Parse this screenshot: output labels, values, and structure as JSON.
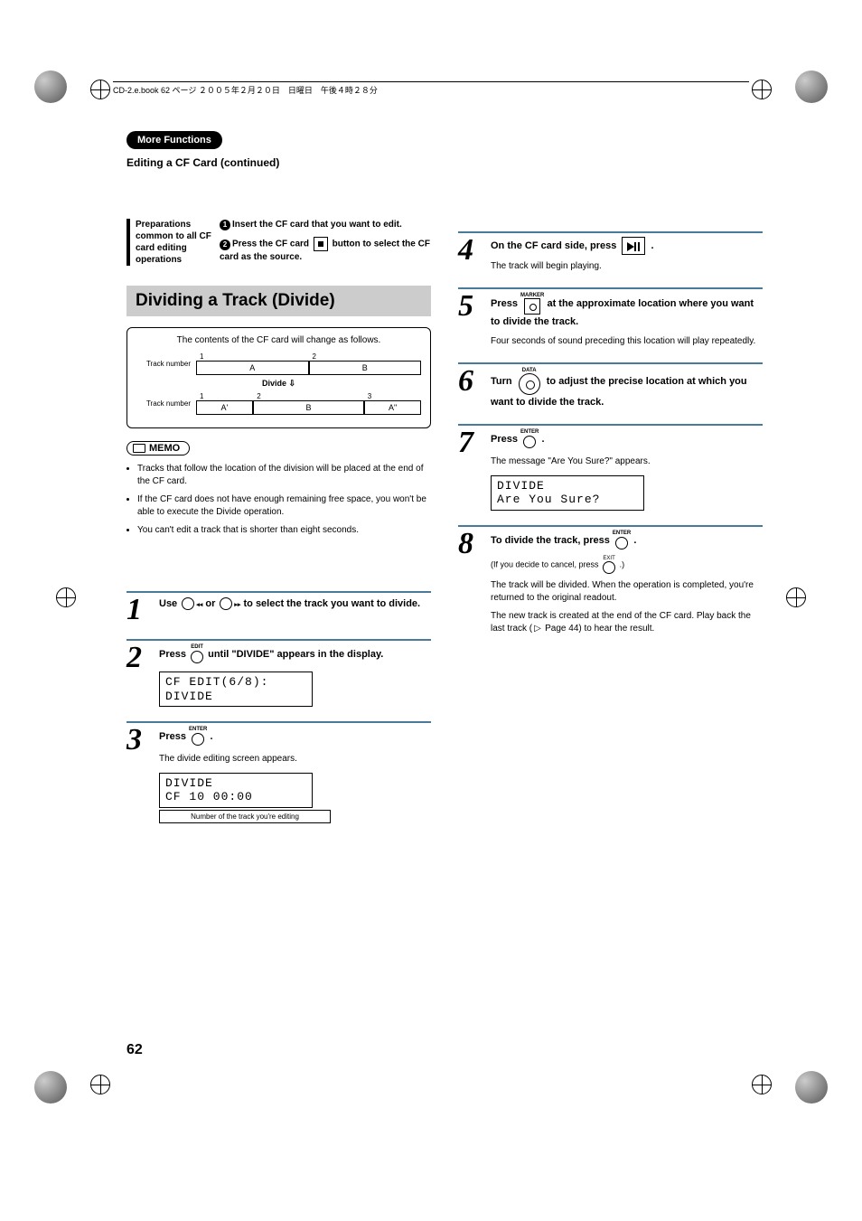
{
  "header": {
    "book_info": "CD-2.e.book  62 ページ  ２００５年２月２０日　日曜日　午後４時２８分"
  },
  "section": {
    "badge": "More Functions",
    "subtitle": "Editing a CF Card (continued)"
  },
  "prep": {
    "left": "Preparations common to all CF card editing operations",
    "item1": "Insert the CF card that you want to edit.",
    "item2_a": "Press the CF card",
    "item2_b": "button to select the CF card as the source."
  },
  "heading": "Dividing a Track (Divide)",
  "diagram": {
    "title": "The contents of the CF card will change as follows.",
    "track_label": "Track number",
    "n1": "1",
    "n2": "2",
    "n3": "3",
    "cA": "A",
    "cB": "B",
    "divide": "Divide",
    "cAp": "A'",
    "cAdp": "A\""
  },
  "memo": {
    "label": "MEMO",
    "items": [
      "Tracks that follow the location of the division will be placed at the end of the CF card.",
      "If the CF card does not have enough remaining free space, you won't be able to execute the Divide operation.",
      "You can't edit a track that is shorter than eight seconds."
    ]
  },
  "steps_left": {
    "s1": {
      "a": "Use",
      "b": "or",
      "c": "to select the track you want to divide."
    },
    "s2": {
      "a": "Press",
      "b": "until \"DIVIDE\" appears in the display.",
      "edit": "EDIT",
      "lcd1": "CF EDIT(6/8):",
      "lcd2": "DIVIDE"
    },
    "s3": {
      "a": "Press",
      "b": ".",
      "enter": "ENTER",
      "desc": "The divide editing screen appears.",
      "lcd1": "DIVIDE",
      "lcd2": "CF  10   00:00",
      "note": "Number of the track you're editing"
    }
  },
  "steps_right": {
    "s4": {
      "a": "On the CF card side, press",
      "b": ".",
      "desc": "The track will begin playing."
    },
    "s5": {
      "a": "Press",
      "b": "at the approximate location where you want to divide the track.",
      "marker": "MARKER",
      "desc": "Four seconds of sound preceding this location will play repeatedly."
    },
    "s6": {
      "a": "Turn",
      "b": "to adjust the precise location at which you want to divide the track.",
      "data": "DATA"
    },
    "s7": {
      "a": "Press",
      "b": ".",
      "enter": "ENTER",
      "desc": "The message \"Are You Sure?\" appears.",
      "lcd1": "DIVIDE",
      "lcd2": "Are You Sure?"
    },
    "s8": {
      "a": "To divide the track, press",
      "b": ".",
      "enter": "ENTER",
      "cancel_a": "(If you decide to cancel, press",
      "cancel_b": ".)",
      "exit": "EXIT",
      "desc1": "The track will be divided. When the operation is completed, you're returned to the original readout.",
      "desc2_a": "The new track is created at the end of the CF card. Play back the last track (",
      "desc2_b": "Page 44) to hear the result."
    }
  },
  "page_number": "62"
}
